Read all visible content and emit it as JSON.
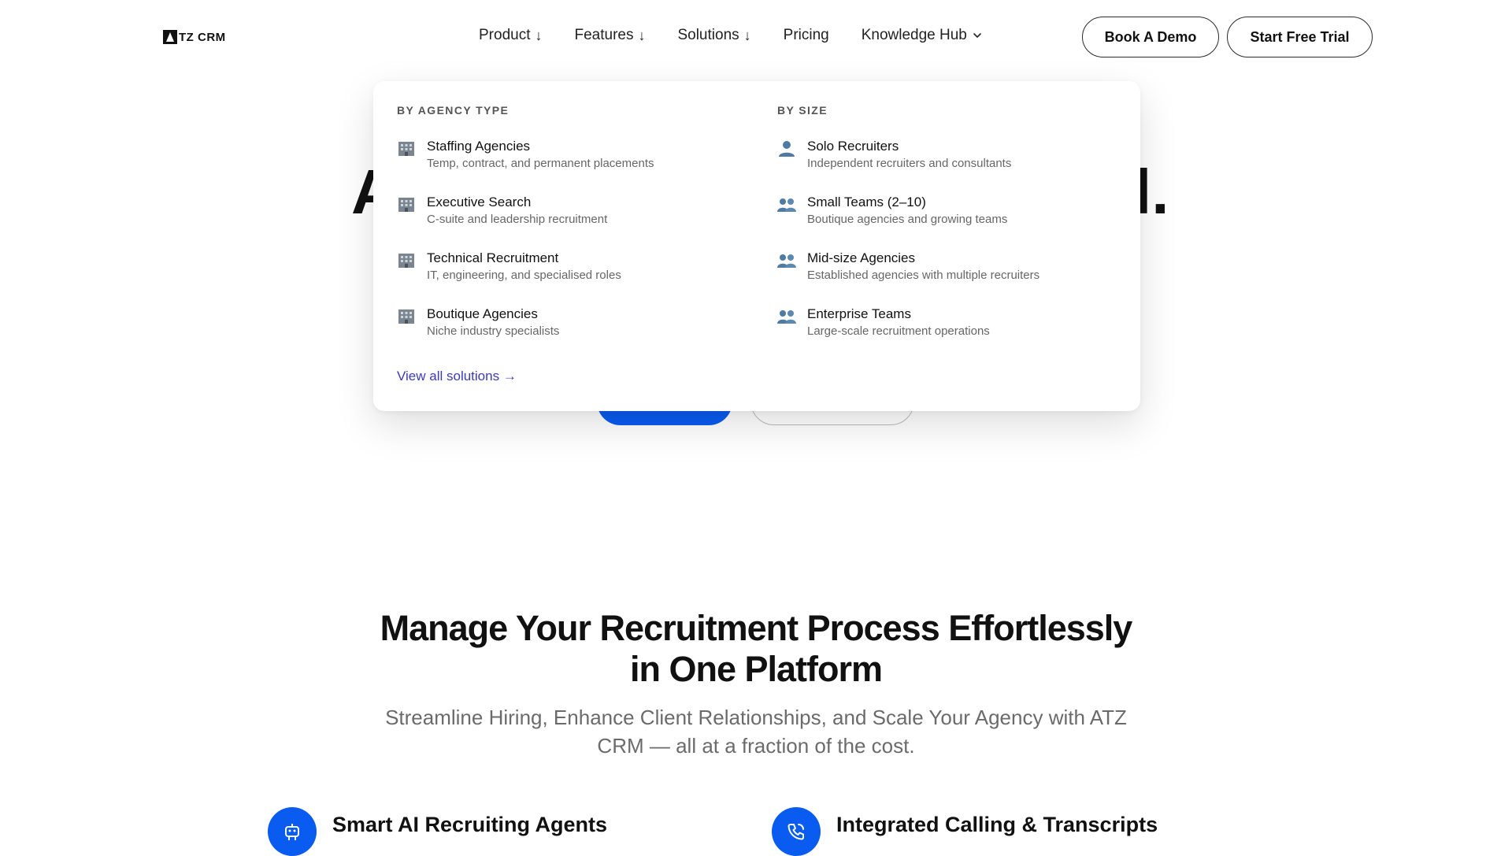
{
  "brand": {
    "name": "TZ CRM"
  },
  "nav": {
    "items": [
      {
        "label": "Product",
        "indicator": "↓"
      },
      {
        "label": "Features",
        "indicator": "↓"
      },
      {
        "label": "Solutions",
        "indicator": "↓"
      },
      {
        "label": "Pricing"
      },
      {
        "label": "Knowledge Hub"
      }
    ],
    "book_demo": "Book A Demo",
    "start_trial": "Start Free Trial"
  },
  "hero": {
    "left_fragment": "A",
    "right_fragment": "l."
  },
  "solutions_menu": {
    "by_agency_type": {
      "heading": "BY AGENCY TYPE",
      "items": [
        {
          "title": "Staffing Agencies",
          "desc": "Temp, contract, and permanent placements",
          "icon": "building-icon"
        },
        {
          "title": "Executive Search",
          "desc": "C-suite and leadership recruitment",
          "icon": "building-icon"
        },
        {
          "title": "Technical Recruitment",
          "desc": "IT, engineering, and specialised roles",
          "icon": "building-icon"
        },
        {
          "title": "Boutique Agencies",
          "desc": "Niche industry specialists",
          "icon": "building-icon"
        }
      ]
    },
    "by_size": {
      "heading": "BY SIZE",
      "items": [
        {
          "title": "Solo Recruiters",
          "desc": "Independent recruiters and consultants",
          "icon": "person-icon"
        },
        {
          "title": "Small Teams (2–10)",
          "desc": "Boutique agencies and growing teams",
          "icon": "people-icon"
        },
        {
          "title": "Mid-size Agencies",
          "desc": "Established agencies with multiple recruiters",
          "icon": "people-icon"
        },
        {
          "title": "Enterprise Teams",
          "desc": "Large-scale recruitment operations",
          "icon": "people-icon"
        }
      ]
    },
    "view_all": "View all solutions →"
  },
  "section": {
    "title_line1": "Manage Your Recruitment Process Effortlessly",
    "title_line2": "in One Platform",
    "subtitle": "Streamline Hiring, Enhance Client Relationships, and Scale Your Agency with ATZ CRM — all at a fraction of the cost."
  },
  "features": [
    {
      "title": "Smart AI Recruiting Agents",
      "icon": "robot-icon"
    },
    {
      "title": "Integrated Calling & Transcripts",
      "icon": "phone-icon"
    }
  ],
  "colors": {
    "accent": "#0a5cf0",
    "link": "#3b3bb8"
  }
}
